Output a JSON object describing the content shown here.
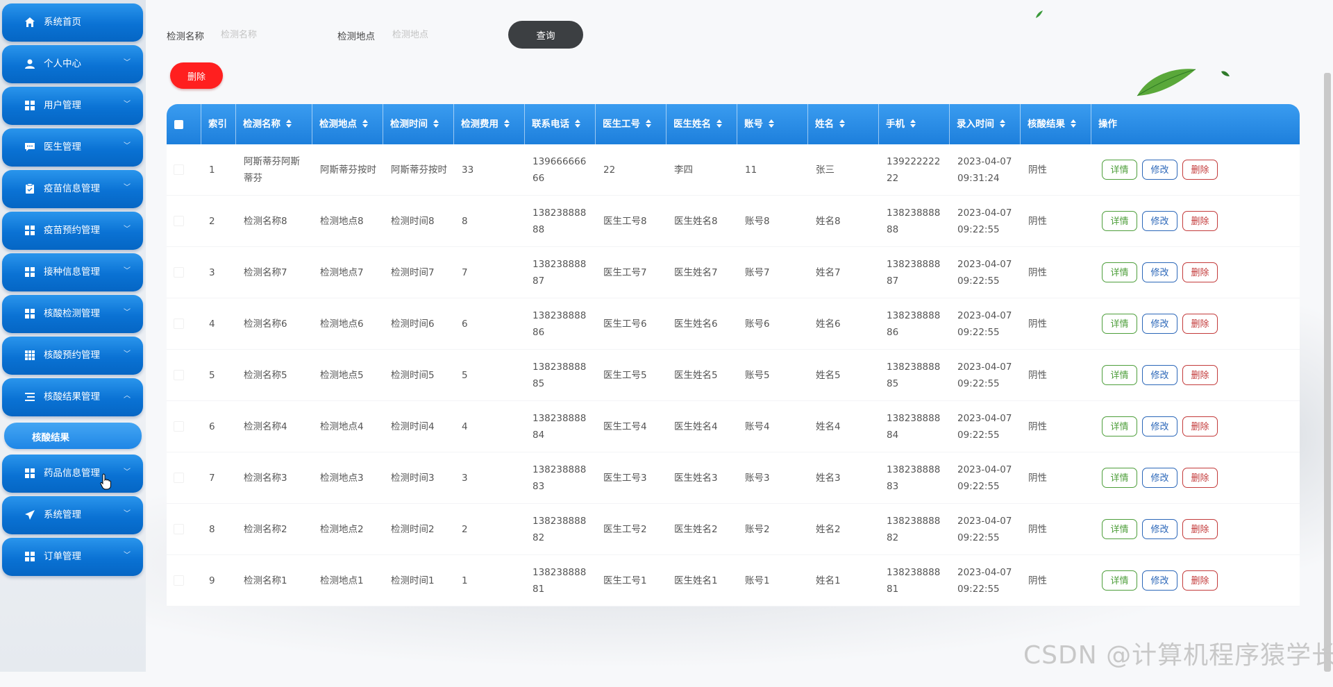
{
  "sidebar": {
    "items": [
      {
        "label": "系统首页",
        "icon": "home-icon",
        "chevron": false
      },
      {
        "label": "个人中心",
        "icon": "user-icon",
        "chevron": true
      },
      {
        "label": "用户管理",
        "icon": "grid-icon",
        "chevron": true
      },
      {
        "label": "医生管理",
        "icon": "chat-icon",
        "chevron": true
      },
      {
        "label": "疫苗信息管理",
        "icon": "clipboard-icon",
        "chevron": true
      },
      {
        "label": "疫苗预约管理",
        "icon": "grid-icon",
        "chevron": true
      },
      {
        "label": "接种信息管理",
        "icon": "grid-icon",
        "chevron": true
      },
      {
        "label": "核酸检测管理",
        "icon": "grid-icon",
        "chevron": true
      },
      {
        "label": "核酸预约管理",
        "icon": "apps-icon",
        "chevron": true
      },
      {
        "label": "核酸结果管理",
        "icon": "list-icon",
        "chevron": true,
        "expanded": true
      },
      {
        "label": "药品信息管理",
        "icon": "grid-icon",
        "chevron": true
      },
      {
        "label": "系统管理",
        "icon": "send-icon",
        "chevron": true
      },
      {
        "label": "订单管理",
        "icon": "grid-icon",
        "chevron": true
      }
    ],
    "submenu": {
      "label": "核酸结果"
    }
  },
  "search": {
    "name_label": "检测名称",
    "name_placeholder": "检测名称",
    "place_label": "检测地点",
    "place_placeholder": "检测地点",
    "query_button": "查询"
  },
  "toolbar": {
    "delete_button": "删除"
  },
  "table": {
    "columns": [
      "索引",
      "检测名称",
      "检测地点",
      "检测时间",
      "检测费用",
      "联系电话",
      "医生工号",
      "医生姓名",
      "账号",
      "姓名",
      "手机",
      "录入时间",
      "核酸结果",
      "操作"
    ],
    "sortable": [
      false,
      true,
      true,
      true,
      true,
      true,
      true,
      true,
      true,
      true,
      true,
      true,
      true,
      false
    ],
    "rows": [
      [
        "1",
        "阿斯蒂芬阿斯蒂芬",
        "阿斯蒂芬按时",
        "阿斯蒂芬按时",
        "33",
        "13966666666",
        "22",
        "李四",
        "11",
        "张三",
        "13922222222",
        "2023-04-07 09:31:24",
        "阴性"
      ],
      [
        "2",
        "检测名称8",
        "检测地点8",
        "检测时间8",
        "8",
        "13823888888",
        "医生工号8",
        "医生姓名8",
        "账号8",
        "姓名8",
        "13823888888",
        "2023-04-07 09:22:55",
        "阴性"
      ],
      [
        "3",
        "检测名称7",
        "检测地点7",
        "检测时间7",
        "7",
        "13823888887",
        "医生工号7",
        "医生姓名7",
        "账号7",
        "姓名7",
        "13823888887",
        "2023-04-07 09:22:55",
        "阴性"
      ],
      [
        "4",
        "检测名称6",
        "检测地点6",
        "检测时间6",
        "6",
        "13823888886",
        "医生工号6",
        "医生姓名6",
        "账号6",
        "姓名6",
        "13823888886",
        "2023-04-07 09:22:55",
        "阴性"
      ],
      [
        "5",
        "检测名称5",
        "检测地点5",
        "检测时间5",
        "5",
        "13823888885",
        "医生工号5",
        "医生姓名5",
        "账号5",
        "姓名5",
        "13823888885",
        "2023-04-07 09:22:55",
        "阴性"
      ],
      [
        "6",
        "检测名称4",
        "检测地点4",
        "检测时间4",
        "4",
        "13823888884",
        "医生工号4",
        "医生姓名4",
        "账号4",
        "姓名4",
        "13823888884",
        "2023-04-07 09:22:55",
        "阴性"
      ],
      [
        "7",
        "检测名称3",
        "检测地点3",
        "检测时间3",
        "3",
        "13823888883",
        "医生工号3",
        "医生姓名3",
        "账号3",
        "姓名3",
        "13823888883",
        "2023-04-07 09:22:55",
        "阴性"
      ],
      [
        "8",
        "检测名称2",
        "检测地点2",
        "检测时间2",
        "2",
        "13823888882",
        "医生工号2",
        "医生姓名2",
        "账号2",
        "姓名2",
        "13823888882",
        "2023-04-07 09:22:55",
        "阴性"
      ],
      [
        "9",
        "检测名称1",
        "检测地点1",
        "检测时间1",
        "1",
        "13823888881",
        "医生工号1",
        "医生姓名1",
        "账号1",
        "姓名1",
        "13823888881",
        "2023-04-07 09:22:55",
        "阴性"
      ]
    ],
    "actions": {
      "detail": "详情",
      "edit": "修改",
      "delete": "删除"
    }
  },
  "watermark": "CSDN @计算机程序猿学长",
  "colors": {
    "accent": "#1d7fdc",
    "query_button": "#3c3f42",
    "delete_button": "#ff1f1f",
    "detail": "#4d9e3a",
    "edit": "#2a66b8",
    "delete": "#c33a3a"
  }
}
